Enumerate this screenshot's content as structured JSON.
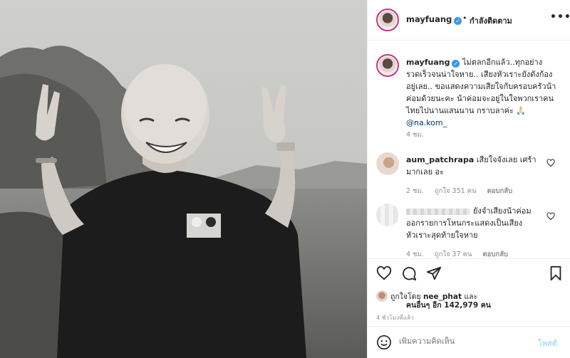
{
  "photo": {
    "alt_subject": "man-peace-signs-lake"
  },
  "header": {
    "username": "mayfuang",
    "verified_mark": "✓",
    "separator": "•",
    "follow_status": "กำลังติดตาม",
    "more": "•••"
  },
  "caption": {
    "username": "mayfuang",
    "text": "ไม่ตลกอีกแล้ว..ทุกอย่างรวดเร็วจนน่าใจหาย.. เสียงหัวเราะยังดังก้องอยู่เลย.. ขอแสดงความเสียใจกับครอบครัวน้าค่อมด้วยนะคะ น้าค่อมจะอยู่ในใจพวกเราคนไทยไปนานแสนนาน กราบลาค่ะ 🙏🏻 ",
    "mention": "@na.kom_",
    "time": "4 ชม."
  },
  "comments": [
    {
      "username": "aum_patchrapa",
      "text": "เสียใจจังเลย เศร้ามากเลย อะ",
      "time": "2 ชม.",
      "likes": "ถูกใจ 351 คน",
      "reply": "ตอบกลับ"
    },
    {
      "username": "",
      "text": "ยังจำเสียงน้าค่อมออกรายการโหนกระแสดงเป็นเสียงหัวเราะสุดท้ายใจหาย",
      "time": "4 ชม.",
      "likes": "ถูกใจ 37 คน",
      "reply": "ตอบกลับ"
    }
  ],
  "likes": {
    "prefix": "ถูกใจโดย",
    "user": "nee_phat",
    "and": "และ",
    "others": "คนอื่นๆ อีก 142,979 คน"
  },
  "post_time": "4 ชั่วโมงที่แล้ว",
  "add_comment": {
    "placeholder": "เพิ่มความคิดเห็น",
    "post_label": "โพสต์"
  },
  "colors": {
    "verified": "#3897f0",
    "link": "#00376b",
    "muted": "#8e8e8e",
    "post_disabled": "#b2dffc"
  }
}
